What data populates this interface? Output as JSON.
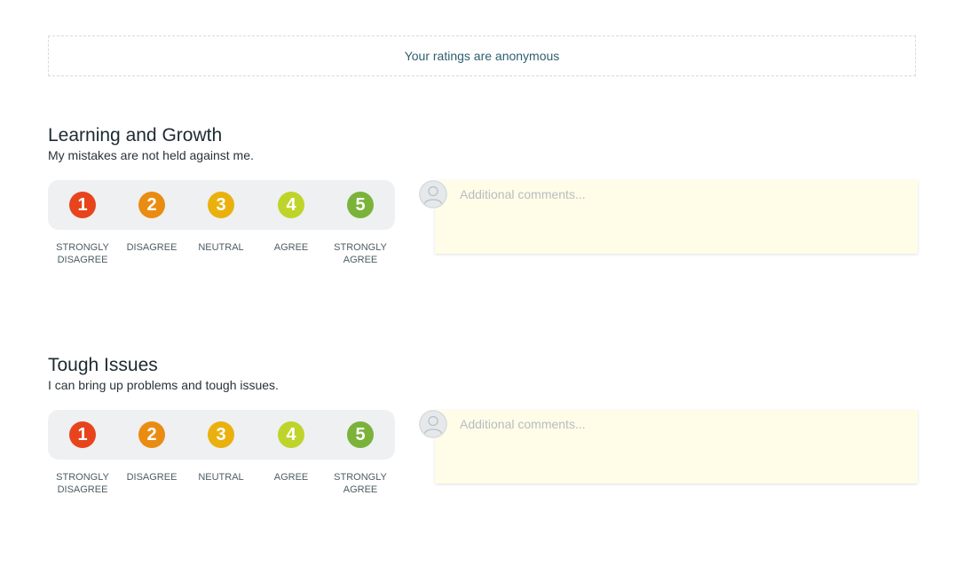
{
  "banner": {
    "text": "Your ratings are anonymous"
  },
  "scale": {
    "options": [
      {
        "number": "1",
        "label": "STRONGLY DISAGREE",
        "color": "#e8441c"
      },
      {
        "number": "2",
        "label": "DISAGREE",
        "color": "#ea8c12"
      },
      {
        "number": "3",
        "label": "NEUTRAL",
        "color": "#eab10e"
      },
      {
        "number": "4",
        "label": "AGREE",
        "color": "#bfd42a"
      },
      {
        "number": "5",
        "label": "STRONGLY AGREE",
        "color": "#7bb33a"
      }
    ]
  },
  "questions": [
    {
      "title": "Learning and Growth",
      "text": "My mistakes are not held against me.",
      "comment_placeholder": "Additional comments...",
      "comment_value": ""
    },
    {
      "title": "Tough Issues",
      "text": "I can bring up problems and tough issues.",
      "comment_placeholder": "Additional comments...",
      "comment_value": ""
    }
  ]
}
